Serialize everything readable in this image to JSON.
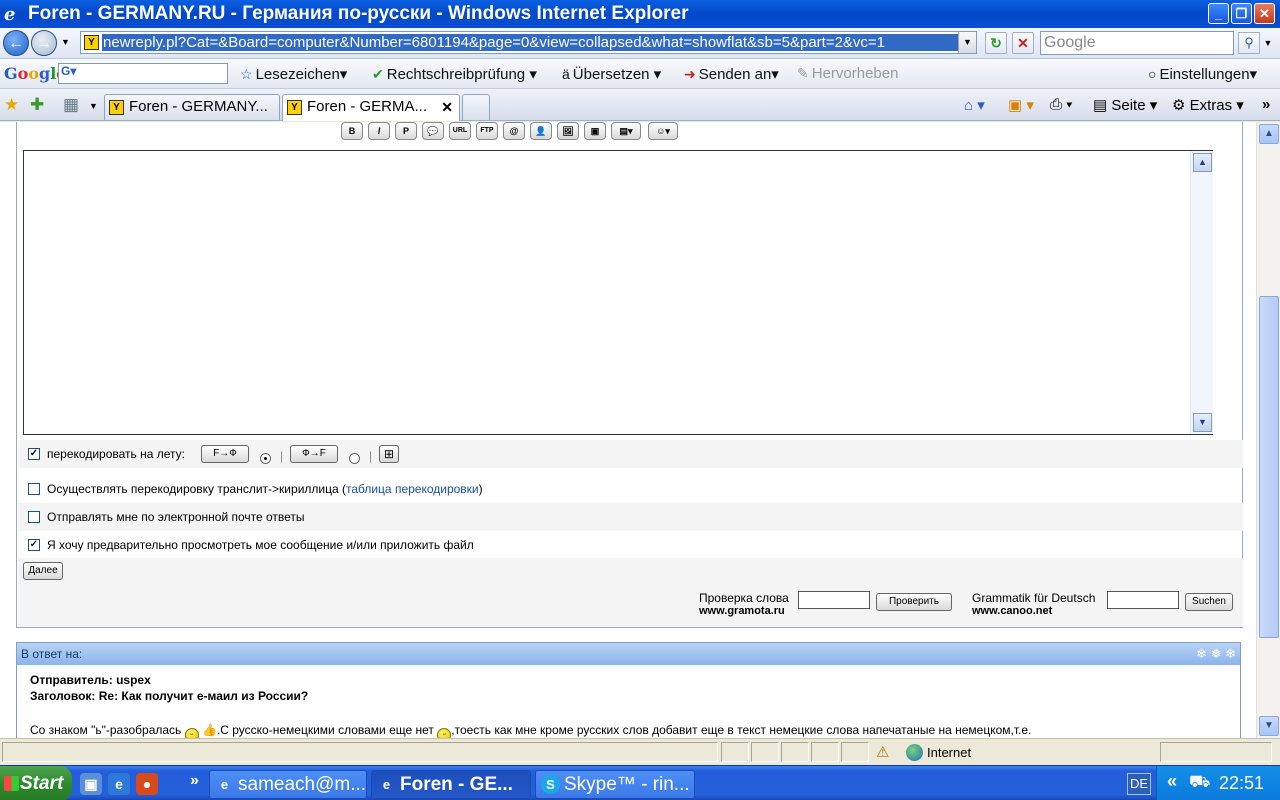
{
  "window": {
    "title": "Foren - GERMANY.RU - Германия по-русски - Windows Internet Explorer",
    "minimize": "_",
    "maximize": "❐",
    "close": "✕"
  },
  "address": {
    "url": "newreply.pl?Cat=&Board=computer&Number=6801194&page=0&view=collapsed&what=showflat&sb=5&part=2&vc=1",
    "search_placeholder": "Google"
  },
  "google_toolbar": {
    "logo": "Google",
    "input_value": "G▾",
    "items": {
      "bookmarks": "Lesezeichen▾",
      "spellcheck": "Rechtschreibprüfung",
      "translate": "Übersetzen",
      "send": "Senden an▾",
      "highlight": "Hervorheben",
      "settings": "Einstellungen▾"
    }
  },
  "tabs": [
    {
      "label": "Foren - GERMANY..."
    },
    {
      "label": "Foren - GERMA..."
    }
  ],
  "commandbar": {
    "page": "Seite",
    "extras": "Extras"
  },
  "format_buttons": [
    "B",
    "I",
    "P",
    "💬",
    "URL",
    "FTP",
    "@",
    "👤",
    "🖼",
    "▣",
    "▤▾",
    "☺▾"
  ],
  "options": {
    "recode_label": "перекодировать на лету:",
    "btn_f_to_ph": "F→Ф",
    "btn_ph_to_f": "Ф→F",
    "table_icon": "⊞",
    "translit_label": "Осуществлять перекодировку транслит->кириллица (",
    "translit_link": "таблица перекодировки",
    "translit_close": ")",
    "email_label": "Отправлять мне по электронной почте ответы",
    "preview_label": "Я хочу предварительно просмотреть мое сообщение и/или приложить файл",
    "next_button": "Далее"
  },
  "spellcheck": {
    "ru_label": "Проверка слова",
    "ru_site": "www.gramota.ru",
    "ru_button": "Проверить",
    "de_label": "Grammatik für Deutsch",
    "de_site": "www.canoo.net",
    "de_button": "Suchen"
  },
  "reply": {
    "header": "В ответ на:",
    "sender_label": "Отправитель: uspex",
    "subject_label": "Заголовок: Re: Как получит е-маил из России?",
    "body_part1": "Со знаком \"ь\"-разобралась",
    "body_part2": ".С русско-немецкими словами еще нет",
    "body_part3": ",тоесть как мне кроме русских слов добавит еще в текст немецкие слова напечатаные на немецком,т.е."
  },
  "statusbar": {
    "zone": "Internet"
  },
  "taskbar": {
    "start": "Start",
    "buttons": [
      {
        "label": "sameach@m..."
      },
      {
        "label": "Foren - GE..."
      },
      {
        "label": "Skype™ - rin..."
      }
    ],
    "lang": "DE",
    "clock": "22:51"
  }
}
